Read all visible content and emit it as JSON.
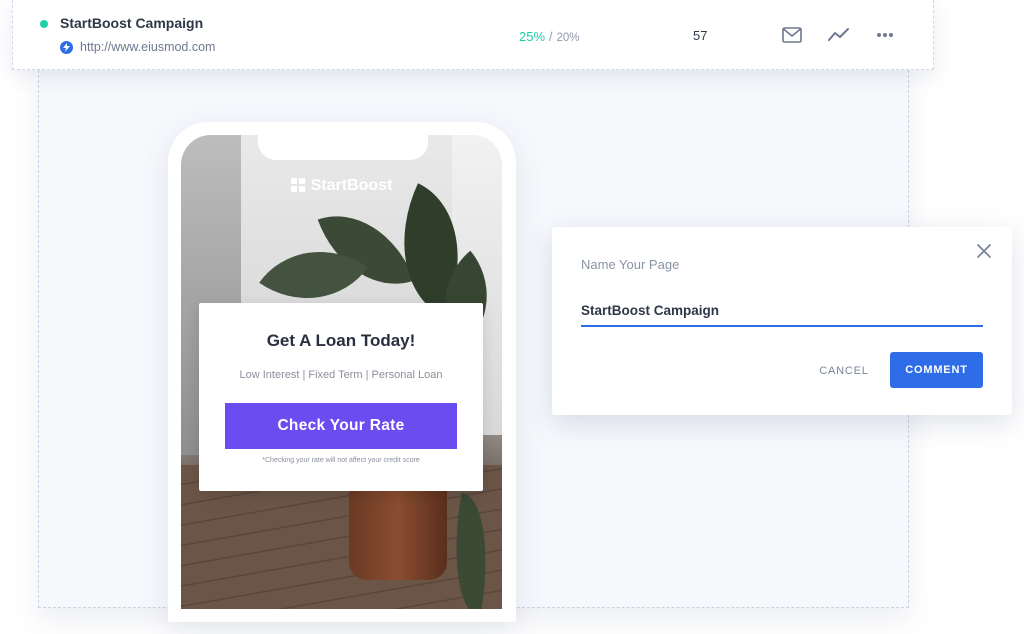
{
  "campaign_row": {
    "title": "StartBoost Campaign",
    "url": "http://www.eiusmod.com",
    "metric_primary": "25%",
    "metric_separator": "/",
    "metric_secondary": "20%",
    "count": "57",
    "status_color": "#1fd1a5",
    "icons": [
      "status-dot",
      "bolt-icon",
      "mail-icon",
      "trend-icon",
      "more-icon"
    ]
  },
  "phone_preview": {
    "brand": "StartBoost",
    "card": {
      "title": "Get A Loan Today!",
      "subtitle": "Low Interest | Fixed Term | Personal Loan",
      "cta": "Check Your Rate",
      "note": "*Checking your rate will not affect your credit score"
    },
    "cta_color": "#6a4cf0"
  },
  "dialog": {
    "label": "Name Your Page",
    "input_value": "StartBoost Campaign",
    "cancel": "CANCEL",
    "confirm": "COMMENT",
    "accent_color": "#2f6de8"
  }
}
